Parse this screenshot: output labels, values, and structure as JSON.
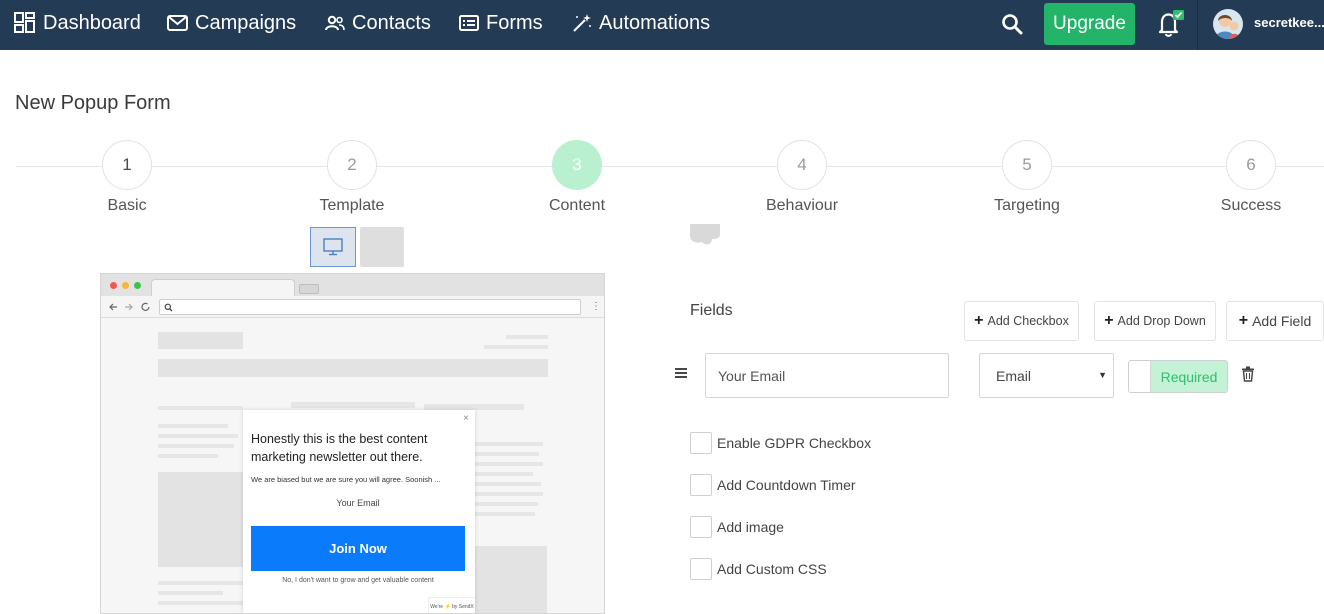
{
  "nav": {
    "items": [
      {
        "label": "Dashboard",
        "icon": "dashboard-grid-icon"
      },
      {
        "label": "Campaigns",
        "icon": "envelope-icon"
      },
      {
        "label": "Contacts",
        "icon": "users-icon"
      },
      {
        "label": "Forms",
        "icon": "form-icon"
      },
      {
        "label": "Automations",
        "icon": "magic-wand-icon"
      }
    ],
    "search_icon": "search-icon",
    "upgrade_label": "Upgrade",
    "bell_icon": "bell-icon",
    "username": "secretkee..."
  },
  "page": {
    "title": "New Popup Form"
  },
  "stepper": {
    "steps": [
      {
        "num": "1",
        "label": "Basic"
      },
      {
        "num": "2",
        "label": "Template"
      },
      {
        "num": "3",
        "label": "Content"
      },
      {
        "num": "4",
        "label": "Behaviour"
      },
      {
        "num": "5",
        "label": "Targeting"
      },
      {
        "num": "6",
        "label": "Success"
      }
    ],
    "active_step": 3
  },
  "preview": {
    "device_selected": "desktop",
    "popup": {
      "close": "×",
      "headline": "Honestly this is the best content marketing newsletter out there.",
      "subtext": "We are biased but we are sure you will agree. Soonish ...",
      "email_placeholder": "Your Email",
      "button_label": "Join Now",
      "decline_text": "No, I don't want to grow and get valuable content",
      "branding": "We're ⚡ by SendX"
    }
  },
  "fields": {
    "title": "Fields",
    "add_checkbox": "Add Checkbox",
    "add_dropdown": "Add Drop Down",
    "add_field": "Add Field",
    "rows": [
      {
        "name": "Your Email",
        "type": "Email",
        "required_label": "Required",
        "required": true
      }
    ]
  },
  "options": [
    {
      "label": "Enable GDPR Checkbox",
      "checked": false
    },
    {
      "label": "Add Countdown Timer",
      "checked": false
    },
    {
      "label": "Add image",
      "checked": false
    },
    {
      "label": "Add Custom CSS",
      "checked": false
    }
  ],
  "colors": {
    "navbar": "#243b55",
    "upgrade": "#23b46a",
    "active_step": "#b8f0d0",
    "join_button": "#0a7cfb",
    "required_on": "#c3f2d7"
  }
}
